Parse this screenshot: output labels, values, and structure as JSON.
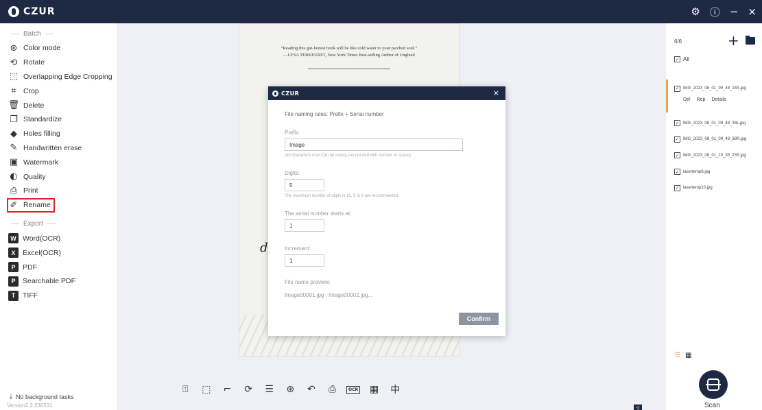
{
  "titlebar": {
    "brand": "CZUR",
    "settings_icon": "gear-icon",
    "help_icon": "help-circle-icon",
    "minimize": "−",
    "close": "×"
  },
  "sidebar": {
    "batch_title": "Batch",
    "batch_items": [
      {
        "label": "Color mode",
        "icon": "color-mode-icon",
        "glyph": "⊛"
      },
      {
        "label": "Rotate",
        "icon": "rotate-icon",
        "glyph": "⟲"
      },
      {
        "label": "Overlapping Edge Cropping",
        "icon": "edge-crop-icon",
        "glyph": "⬚"
      },
      {
        "label": "Crop",
        "icon": "crop-icon",
        "glyph": "⌗"
      },
      {
        "label": "Delete",
        "icon": "trash-icon",
        "glyph": "🗑"
      },
      {
        "label": "Standardize",
        "icon": "standardize-icon",
        "glyph": "❐"
      },
      {
        "label": "Holes filling",
        "icon": "holes-filling-icon",
        "glyph": "◆"
      },
      {
        "label": "Handwritten erase",
        "icon": "handwritten-erase-icon",
        "glyph": "✎"
      },
      {
        "label": "Watermark",
        "icon": "watermark-icon",
        "glyph": "▣"
      },
      {
        "label": "Quality",
        "icon": "quality-icon",
        "glyph": "◐"
      },
      {
        "label": "Print",
        "icon": "printer-icon",
        "glyph": "⎙"
      },
      {
        "label": "Rename",
        "icon": "rename-icon",
        "glyph": "✐"
      }
    ],
    "export_title": "Export",
    "export_items": [
      {
        "label": "Word(OCR)",
        "icon": "word-icon",
        "badge": "W"
      },
      {
        "label": "Excel(OCR)",
        "icon": "excel-icon",
        "badge": "X"
      },
      {
        "label": "PDF",
        "icon": "pdf-icon",
        "badge": "P"
      },
      {
        "label": "Searchable PDF",
        "icon": "searchable-pdf-icon",
        "badge": "P"
      },
      {
        "label": "TIFF",
        "icon": "tiff-icon",
        "badge": "T"
      }
    ],
    "bg_tasks": "No background tasks",
    "version": "Version2.2.230531"
  },
  "document": {
    "quote_line1": "“Reading this gut-honest book will be like cold water to your parched soul.”",
    "quote_line2": "—LYSA TERKEURST, New York Times Best-selling Author of Unglued"
  },
  "dialog": {
    "brand": "CZUR",
    "rule": "File naming rules: Prefix + Serial number",
    "prefix_label": "Prefix",
    "prefix_value": "Image",
    "prefix_hint": "(40 characters max.Can be empty,can not end with number or space)",
    "digits_label": "Digits:",
    "digits_value": "5",
    "digits_hint": "The maximum number of digits is 15, 5 to 8 are recommended.",
    "start_label": "The serial number starts at:",
    "start_value": "1",
    "increment_label": "Increment:",
    "increment_value": "1",
    "preview_label": "File name preview:",
    "preview_value": "Image00001.jpg , Image00002.jpg...",
    "confirm": "Confirm"
  },
  "toolbar": {
    "tools": [
      {
        "name": "fit-page-icon",
        "glyph": "⍐"
      },
      {
        "name": "select-area-icon",
        "glyph": "⬚"
      },
      {
        "name": "crop-tool-icon",
        "glyph": "⌐"
      },
      {
        "name": "rotate-tool-icon",
        "glyph": "⟳"
      },
      {
        "name": "adjust-icon",
        "glyph": "☰"
      },
      {
        "name": "color-tool-icon",
        "glyph": "⊛"
      },
      {
        "name": "undo-icon",
        "glyph": "↶"
      },
      {
        "name": "print-tool-icon",
        "glyph": "⎙"
      },
      {
        "name": "ocr-icon",
        "glyph": "OCR"
      },
      {
        "name": "qr-code-icon",
        "glyph": "▦"
      },
      {
        "name": "split-icon",
        "glyph": "中"
      }
    ]
  },
  "right_panel": {
    "count": "6/6",
    "all_label": "All",
    "selected_file": "IMG_2023_08_01_09_48_24S.jpg",
    "file_actions": [
      "Del",
      "Rep",
      "Details"
    ],
    "files": [
      "IMG_2023_08_01_09_48_38L.jpg",
      "IMG_2023_08_01_09_48_38R.jpg",
      "IMG_2023_08_01_10_35_23S.jpg",
      "lasertemp8.jpg",
      "lasertemp10.jpg"
    ],
    "scan_label": "Scan"
  }
}
